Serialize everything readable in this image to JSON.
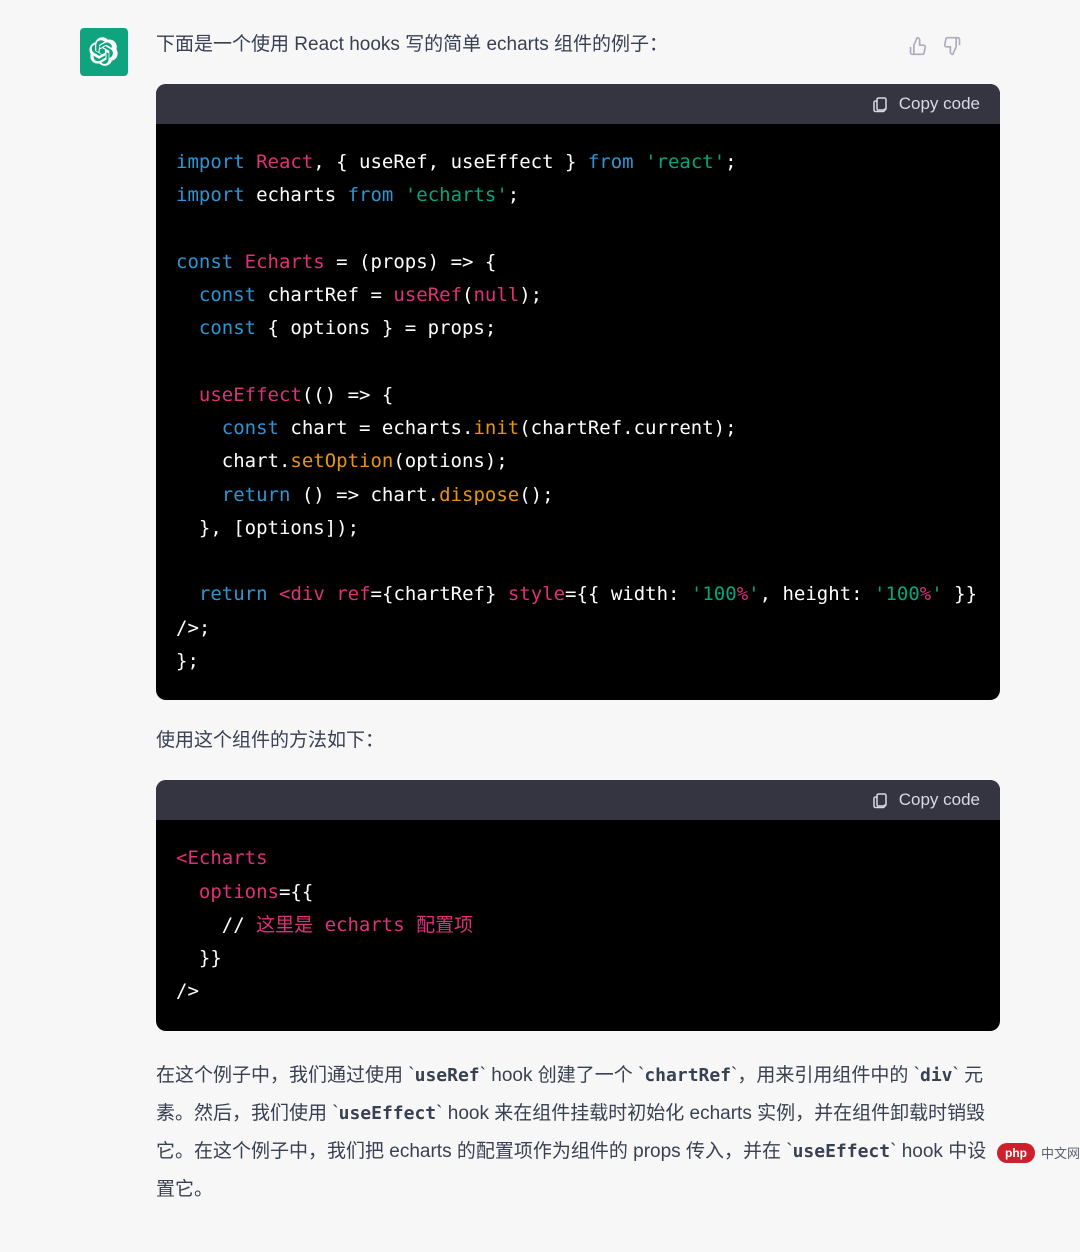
{
  "message": {
    "intro": "下面是一个使用 React hooks 写的简单 echarts 组件的例子：",
    "middle": "使用这个组件的方法如下：",
    "outro_parts": {
      "p1": "在这个例子中，我们通过使用 `",
      "c1": "useRef",
      "p2": "` hook 创建了一个 `",
      "c2": "chartRef",
      "p3": "`，用来引用组件中的 `",
      "c3": "div",
      "p4": "` 元素。然后，我们使用 `",
      "c4": "useEffect",
      "p5": "` hook 来在组件挂载时初始化 echarts 实例，并在组件卸载时销毁它。在这个例子中，我们把 echarts 的配置项作为组件的 props 传入，并在 `",
      "c5": "useEffect",
      "p6": "` hook 中设置它。"
    }
  },
  "code_header": {
    "copy_label": "Copy code"
  },
  "code1": {
    "l1": {
      "import": "import",
      "react": "React",
      "comma": ", { useRef, useEffect } ",
      "from": "from",
      "sp": " ",
      "str": "'react'",
      "semi": ";"
    },
    "l2": {
      "import": "import",
      "sp1": " echarts ",
      "from": "from",
      "sp2": " ",
      "str": "'echarts'",
      "semi": ";"
    },
    "l3": "",
    "l4": {
      "const": "const",
      "sp": " ",
      "name": "Echarts",
      "rest": " = (props) => {"
    },
    "l5": {
      "pad": "  ",
      "const": "const",
      "mid": " chartRef = ",
      "fn": "useRef",
      "open": "(",
      "null": "null",
      "close": ");"
    },
    "l6": {
      "pad": "  ",
      "const": "const",
      "rest": " { options } = props;"
    },
    "l7": "",
    "l8": {
      "pad": "  ",
      "fn": "useEffect",
      "rest": "(() => {"
    },
    "l9": {
      "pad": "    ",
      "const": "const",
      "mid": " chart = echarts.",
      "fn": "init",
      "rest": "(chartRef.current);"
    },
    "l10": {
      "pad": "    chart.",
      "fn": "setOption",
      "rest": "(options);"
    },
    "l11": {
      "pad": "    ",
      "ret": "return",
      "mid": " () => chart.",
      "fn": "dispose",
      "rest": "();"
    },
    "l12": {
      "text": "  }, [options]);"
    },
    "l13": "",
    "l14": {
      "pad": "  ",
      "ret": "return",
      "sp": " ",
      "lt": "<",
      "tag": "div",
      "sp2": " ",
      "a1": "ref",
      "eq1": "=",
      "v1": "{chartRef}",
      "sp3": " ",
      "a2": "style",
      "eq2": "=",
      "br": "{{ ",
      "k1": "width",
      "c1": ": ",
      "s1a": "'100",
      "pct1": "%",
      "s1b": "'",
      "cm": ", ",
      "k2": "height",
      "c2": ": ",
      "s2a": "'100",
      "pct2": "%",
      "s2b": "'",
      "end": " }} />;"
    },
    "l15": {
      "text": "};"
    }
  },
  "code2": {
    "l1": {
      "lt": "<",
      "tag": "Echarts"
    },
    "l2": {
      "pad": "  ",
      "attr": "options",
      "rest": "={{"
    },
    "l3": {
      "pad": "    ",
      "slashes": "// ",
      "a": "这里是",
      "sp1": " ",
      "b": "echarts",
      "sp2": " ",
      "c": "配置项"
    },
    "l4": {
      "text": "  }}"
    },
    "l5": {
      "text": "/>"
    }
  },
  "watermark": {
    "badge": "php",
    "text": "中文网"
  }
}
